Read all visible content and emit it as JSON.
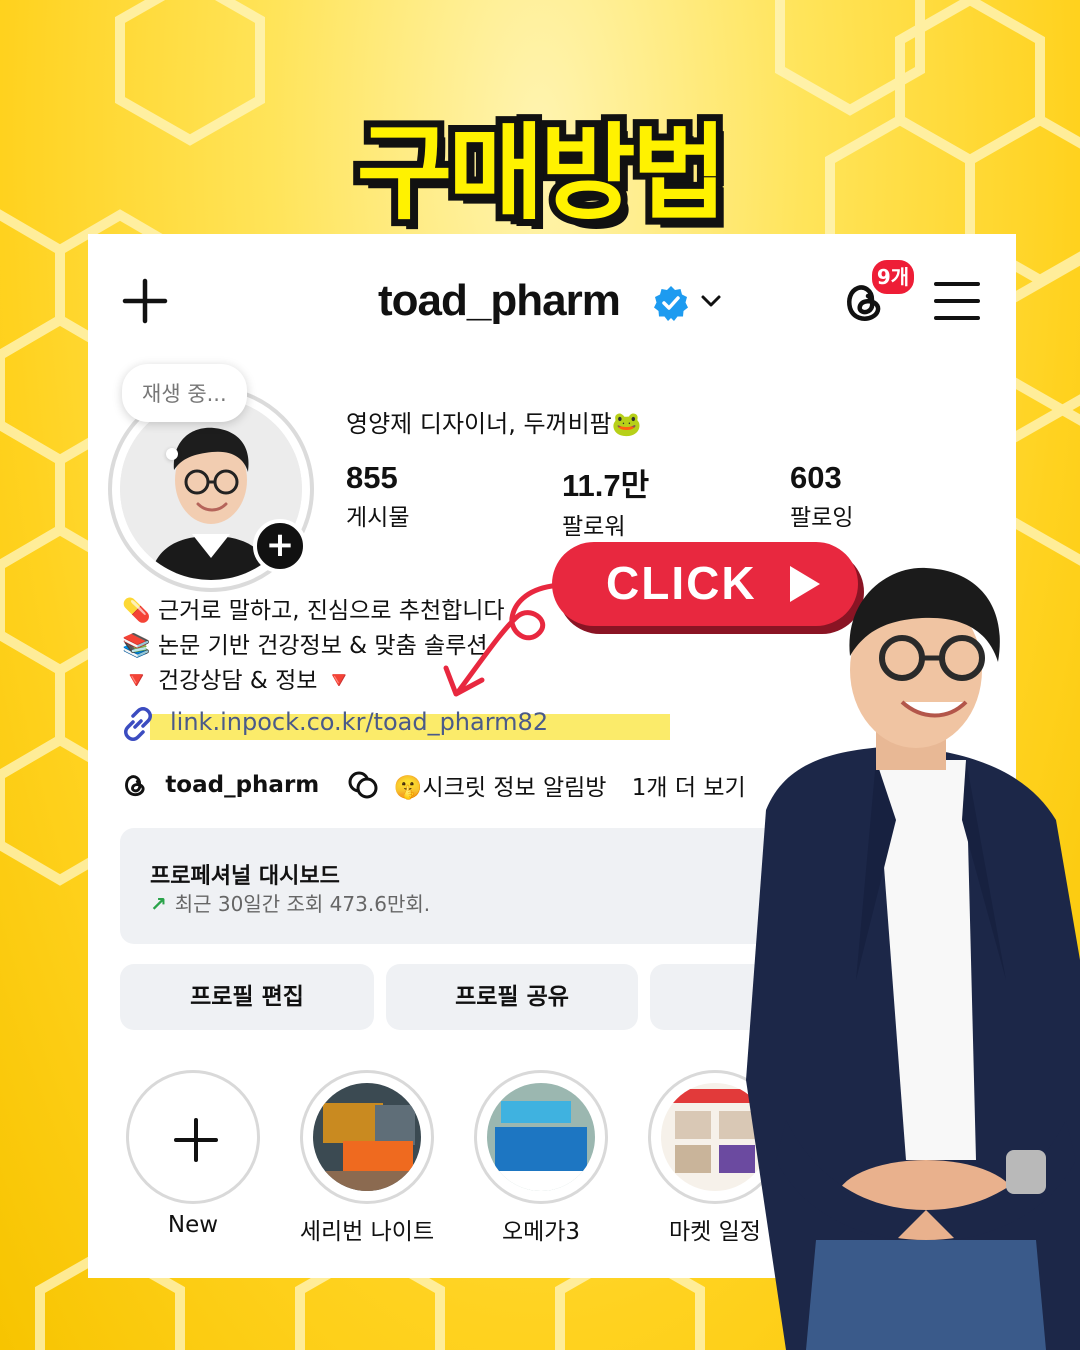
{
  "headline": "구매방법",
  "profile": {
    "username": "toad_pharm",
    "notification_count": "9개",
    "note": "재생 중...",
    "display_name": "영양제 디자이너, 두꺼비팜🐸",
    "stats": [
      {
        "value": "855",
        "label": "게시물"
      },
      {
        "value": "11.7만",
        "label": "팔로워"
      },
      {
        "value": "603",
        "label": "팔로잉"
      }
    ],
    "bio": [
      "💊 근거로 말하고, 진심으로 추천합니다",
      "📚 논문 기반 건강정보 & 맞춤 솔루션",
      "🔻 건강상담 & 정보 🔻"
    ],
    "link": "link.inpock.co.kr/toad_pharm82",
    "threads_handle": "toad_pharm",
    "channel": "🤫시크릿 정보 알림방",
    "more": "1개 더 보기"
  },
  "dashboard": {
    "title": "프로페셔널 대시보드",
    "subtitle": "최근 30일간 조회 473.6만회."
  },
  "buttons": {
    "edit": "프로필 편집",
    "share": "프로필 공유"
  },
  "highlights": [
    {
      "label": "New"
    },
    {
      "label": "세리번 나이트"
    },
    {
      "label": "오메가3"
    },
    {
      "label": "마켓 일정"
    }
  ],
  "cta": {
    "label": "CLICK",
    "color": "#e8283f"
  },
  "colors": {
    "background": "#ffd21f",
    "headline_fill": "#fff200",
    "verified": "#1d9bf0",
    "link_highlight": "#fbeb6a"
  }
}
